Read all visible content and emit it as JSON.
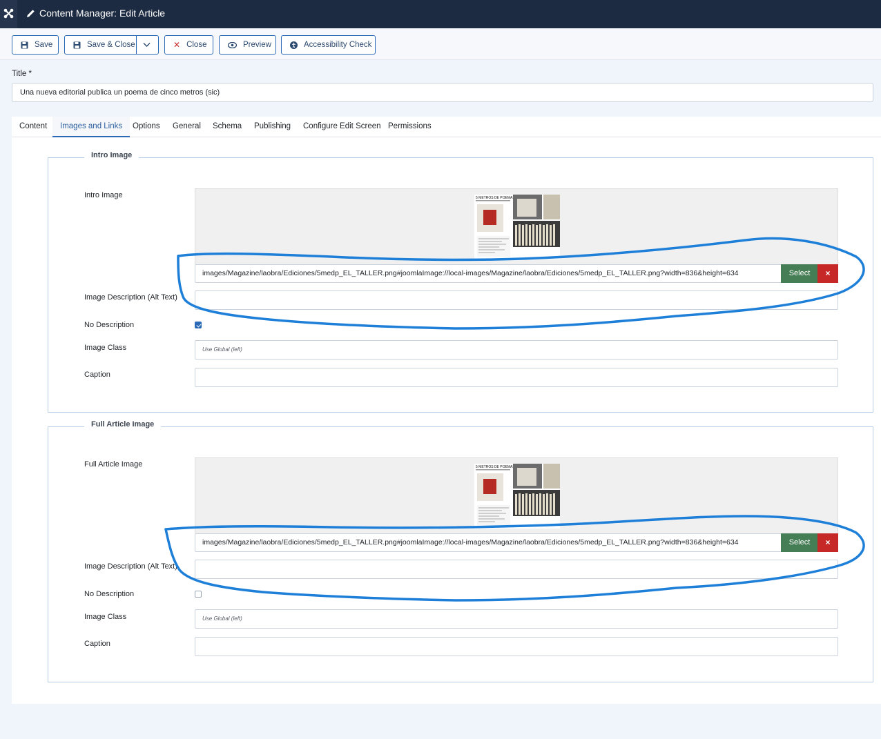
{
  "header": {
    "title": "Content Manager: Edit Article",
    "logo_icon": "joomla-icon",
    "title_icon": "pencil-icon"
  },
  "toolbar": {
    "save": "Save",
    "save_close": "Save & Close",
    "close": "Close",
    "preview": "Preview",
    "accessibility": "Accessibility Check"
  },
  "title_field": {
    "label": "Title *",
    "value": "Una nueva editorial publica un poema de cinco metros (sic)"
  },
  "tabs": [
    "Content",
    "Images and Links",
    "Options",
    "General",
    "Schema",
    "Publishing",
    "Configure Edit Screen",
    "Permissions"
  ],
  "active_tab": "Images and Links",
  "intro": {
    "legend": "Intro Image",
    "image_label": "Intro Image",
    "url": "images/Magazine/laobra/Ediciones/5medp_EL_TALLER.png#joomlaImage://local-images/Magazine/laobra/Ediciones/5medp_EL_TALLER.png?width=836&height=634",
    "select": "Select",
    "clear": "×",
    "alt_label": "Image Description (Alt Text)",
    "alt_value": "",
    "nodesc_label": "No Description",
    "nodesc_checked": true,
    "class_label": "Image Class",
    "class_value": "Use Global (left)",
    "caption_label": "Caption",
    "caption_value": "",
    "thumb_heading": "5 METROS DE POEMAS"
  },
  "full": {
    "legend": "Full Article Image",
    "image_label": "Full Article Image",
    "url": "images/Magazine/laobra/Ediciones/5medp_EL_TALLER.png#joomlaImage://local-images/Magazine/laobra/Ediciones/5medp_EL_TALLER.png?width=836&height=634",
    "select": "Select",
    "clear": "×",
    "alt_label": "Image Description (Alt Text)",
    "alt_value": "",
    "nodesc_label": "No Description",
    "nodesc_checked": false,
    "class_label": "Image Class",
    "class_value": "Use Global (left)",
    "caption_label": "Caption",
    "caption_value": "",
    "thumb_heading": "5 METROS DE POEMAS"
  },
  "colors": {
    "header": "#1c2b41",
    "accent": "#2a69b8",
    "select": "#457d54",
    "clear": "#c52827",
    "annotation": "#1e7fd8"
  }
}
